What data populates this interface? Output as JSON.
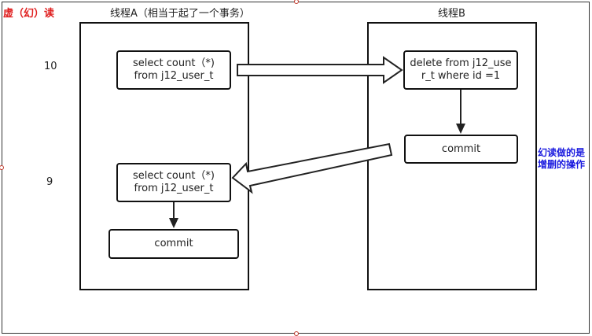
{
  "title": "虚（幻）读",
  "threadA": {
    "label": "线程A（相当于起了一个事务）"
  },
  "threadB": {
    "label": "线程B"
  },
  "counts": {
    "first": "10",
    "second": "9"
  },
  "boxes": {
    "a_select1": {
      "line1": "select count（*)",
      "line2": "from j12_user_t"
    },
    "a_select2": {
      "line1": "select count（*)",
      "line2": "from j12_user_t"
    },
    "a_commit": {
      "text": "commit"
    },
    "b_delete": {
      "line1": "delete from j12_use",
      "line2": "r_t  where id =1"
    },
    "b_commit": {
      "text": "commit"
    }
  },
  "note": {
    "line1": "幻读做的是",
    "line2": "增删的操作"
  },
  "colors": {
    "title": "#e02020",
    "note": "#1a1adf",
    "handle": "#c0392b"
  }
}
